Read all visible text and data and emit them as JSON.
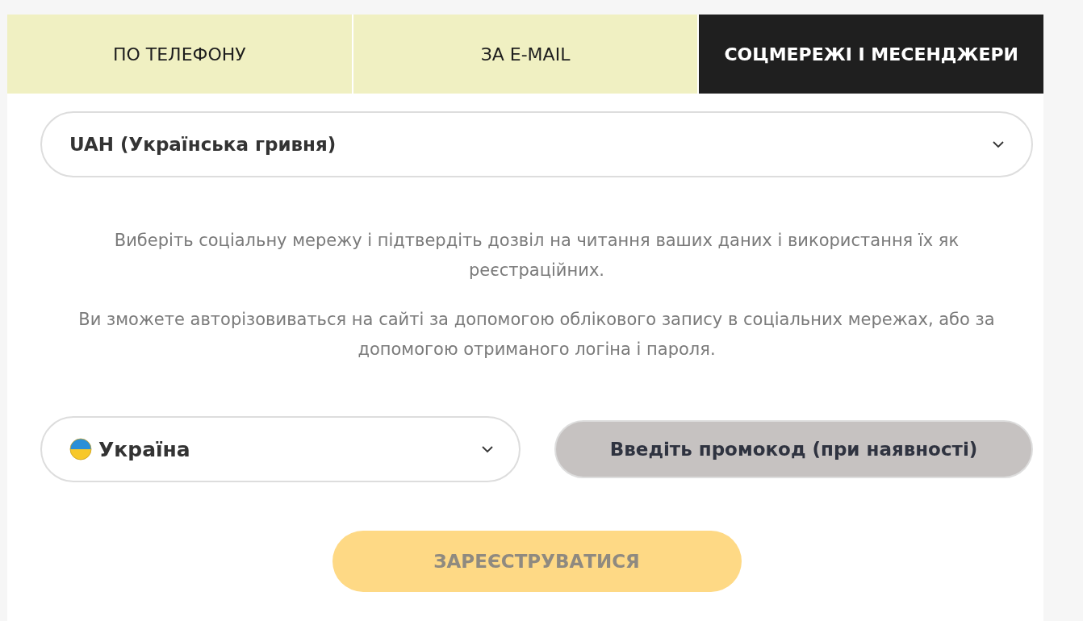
{
  "tabs": [
    {
      "label": "ПО ТЕЛЕФОНУ",
      "selected": false
    },
    {
      "label": "ЗА E-MAIL",
      "selected": false
    },
    {
      "label": "СОЦМЕРЕЖІ І МЕСЕНДЖЕРИ",
      "selected": true
    }
  ],
  "currency_select": {
    "value": "UAH (Українська гривня)"
  },
  "info_paragraphs": [
    "Виберіть соціальну мережу і підтвердіть дозвіл на читання ваших даних і використання їх як реєстраційних.",
    "Ви зможете авторізовиваться на сайті за допомогою облікового запису в соціальних мережах, або за допомогою отриманого логіна і пароля."
  ],
  "country_select": {
    "value": "Україна"
  },
  "promo_button": {
    "label": "Введіть промокод (при наявності)"
  },
  "register_button": {
    "label": "ЗАРЕЄСТРУВАТИСЯ",
    "disabled": true
  }
}
